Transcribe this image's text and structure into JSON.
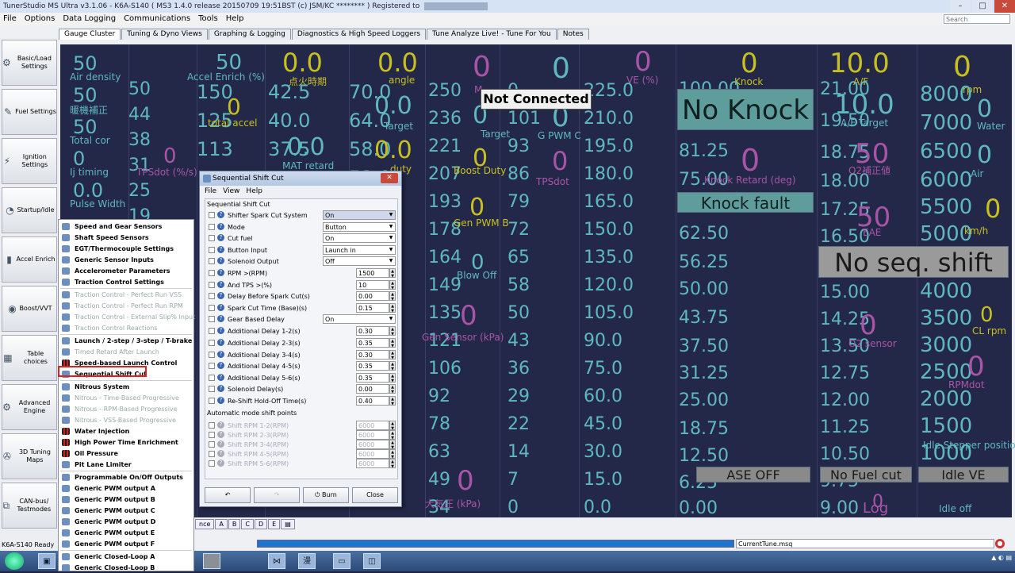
{
  "window": {
    "title": "TunerStudio MS Ultra v3.1.06 - K6A-S140 ( MS3 1.4.0 release   20150709 19:51BST (c) JSM/KC ******** ) Registered to"
  },
  "menubar": [
    "File",
    "Options",
    "Data Logging",
    "Communications",
    "Tools",
    "Help"
  ],
  "search": {
    "placeholder": "Search"
  },
  "tabs": [
    "Gauge Cluster",
    "Tuning & Dyno Views",
    "Graphing & Logging",
    "Diagnostics & High Speed Loggers",
    "Tune Analyze Live! - Tune For You",
    "Notes"
  ],
  "sidebar": [
    {
      "label": "Basic/Load Settings",
      "icon": "gear-icon"
    },
    {
      "label": "Fuel Settings",
      "icon": "injector-icon"
    },
    {
      "label": "Ignition Settings",
      "icon": "spark-icon"
    },
    {
      "label": "Startup/Idle",
      "icon": "gauge-icon"
    },
    {
      "label": "Accel Enrich",
      "icon": "pedal-icon"
    },
    {
      "label": "Boost/VVT",
      "icon": "turbo-icon"
    },
    {
      "label": "Table choices",
      "icon": "table-icon"
    },
    {
      "label": "Advanced Engine",
      "icon": "engine-icon"
    },
    {
      "label": "3D Tuning Maps",
      "icon": "wrench-icon"
    },
    {
      "label": "CAN-bus/ Testmodes",
      "icon": "network-icon"
    }
  ],
  "context_menu": [
    {
      "label": "Speed and Gear Sensors",
      "enabled": true
    },
    {
      "label": "Shaft Speed Sensors",
      "enabled": true
    },
    {
      "label": "EGT/Thermocouple Settings",
      "enabled": true
    },
    {
      "label": "Generic Sensor Inputs",
      "enabled": true
    },
    {
      "label": "Accelerometer Parameters",
      "enabled": true
    },
    {
      "label": "Traction Control Settings",
      "enabled": true
    },
    {
      "label": "Traction Control - Perfect Run VSS",
      "enabled": false
    },
    {
      "label": "Traction Control - Perfect Run RPM",
      "enabled": false
    },
    {
      "label": "Traction Control - External Slip% Input",
      "enabled": false
    },
    {
      "label": "Traction Control Reactions",
      "enabled": false
    },
    {
      "label": "Launch / 2-step / 3-step / T-brake",
      "enabled": true
    },
    {
      "label": "Timed Retard After Launch",
      "enabled": false
    },
    {
      "label": "Speed-based Launch Control",
      "enabled": true
    },
    {
      "label": "Sequential Shift Cut",
      "enabled": true
    },
    {
      "label": "Nitrous System",
      "enabled": true
    },
    {
      "label": "Nitrous - Time-Based Progressive",
      "enabled": false
    },
    {
      "label": "Nitrous - RPM-Based Progressive",
      "enabled": false
    },
    {
      "label": "Nitrous - VSS-Based Progressive",
      "enabled": false
    },
    {
      "label": "Water Injection",
      "enabled": true
    },
    {
      "label": "High Power Time Enrichment",
      "enabled": true
    },
    {
      "label": "Oil Pressure",
      "enabled": true
    },
    {
      "label": "Pit Lane Limiter",
      "enabled": true
    },
    {
      "label": "Programmable On/Off Outputs",
      "enabled": true
    },
    {
      "label": "Generic PWM output A",
      "enabled": true
    },
    {
      "label": "Generic PWM output B",
      "enabled": true
    },
    {
      "label": "Generic PWM output C",
      "enabled": true
    },
    {
      "label": "Generic PWM output D",
      "enabled": true
    },
    {
      "label": "Generic PWM output E",
      "enabled": true
    },
    {
      "label": "Generic PWM output F",
      "enabled": true
    },
    {
      "label": "Generic Closed-Loop A",
      "enabled": true
    },
    {
      "label": "Generic Closed-Loop B",
      "enabled": true
    }
  ],
  "dialog": {
    "title": "Sequential Shift Cut",
    "menu": [
      "File",
      "View",
      "Help"
    ],
    "section": "Sequential Shift Cut",
    "rows": [
      {
        "label": "Shifter Spark Cut System",
        "type": "select",
        "value": "On"
      },
      {
        "label": "Mode",
        "type": "select",
        "value": "Button"
      },
      {
        "label": "Cut fuel",
        "type": "select",
        "value": "On"
      },
      {
        "label": "Button Input",
        "type": "select",
        "value": "Launch in"
      },
      {
        "label": "Solenoid Output",
        "type": "select",
        "value": "Off"
      },
      {
        "label": "RPM >(RPM)",
        "type": "num",
        "value": "1500"
      },
      {
        "label": "And TPS >(%)",
        "type": "num",
        "value": "10"
      },
      {
        "label": "Delay Before Spark Cut(s)",
        "type": "num",
        "value": "0.00"
      },
      {
        "label": "Spark Cut Time (Base)(s)",
        "type": "num",
        "value": "0.15"
      },
      {
        "label": "Gear Based Delay",
        "type": "select",
        "value": "On"
      },
      {
        "label": "Additional Delay 1-2(s)",
        "type": "num",
        "value": "0.30"
      },
      {
        "label": "Additional Delay 2-3(s)",
        "type": "num",
        "value": "0.35"
      },
      {
        "label": "Additional Delay 3-4(s)",
        "type": "num",
        "value": "0.30"
      },
      {
        "label": "Additional Delay 4-5(s)",
        "type": "num",
        "value": "0.35"
      },
      {
        "label": "Additional Delay 5-6(s)",
        "type": "num",
        "value": "0.35"
      },
      {
        "label": "Solenoid Delay(s)",
        "type": "num",
        "value": "0.00"
      },
      {
        "label": "Re-Shift Hold-Off Time(s)",
        "type": "num",
        "value": "0.40"
      }
    ],
    "auto_section": "Automatic mode shift points",
    "auto_rows": [
      {
        "label": "Shift RPM 1-2(RPM)",
        "value": "6000"
      },
      {
        "label": "Shift RPM 2-3(RPM)",
        "value": "6000"
      },
      {
        "label": "Shift RPM 3-4(RPM)",
        "value": "6000"
      },
      {
        "label": "Shift RPM 4-5(RPM)",
        "value": "6000"
      },
      {
        "label": "Shift RPM 5-6(RPM)",
        "value": "6000"
      }
    ],
    "buttons": {
      "undo": "↶",
      "redo": "↷",
      "burn": "Burn",
      "close": "Close"
    }
  },
  "status": {
    "left": "K6A-S140 Ready",
    "tune": "CurrentTune.msq",
    "not_connected": "Not Connected"
  },
  "bottom_tabs": [
    "nce",
    "A",
    "B",
    "C",
    "D",
    "E"
  ],
  "indicators": {
    "no_knock": "No Knock",
    "knock_fault": "Knock fault",
    "no_seq_shift": "No seq. shift",
    "ase_off": "ASE OFF",
    "no_fuel_cut": "No Fuel cut",
    "idle_ve": "Idle VE"
  },
  "gauges": {
    "col1": {
      "values": [
        "50",
        "50",
        "50",
        "0",
        "0.0"
      ],
      "labels": [
        "Air density",
        "暖機補正",
        "Total cor",
        "Ij timing",
        "Pulse Width"
      ]
    },
    "col1b": {
      "values": [
        "50",
        "44",
        "38",
        "31",
        "25",
        "19"
      ]
    },
    "col2": {
      "top": "50",
      "label": "Accel Enrich (%)",
      "values": [
        "150",
        "125",
        "113"
      ],
      "ov1": "0",
      "ovlab1": "total accel",
      "ov2": "0",
      "ovlab2": "TPSdot (%/s)"
    },
    "col3": {
      "top": "0.0",
      "label": "点火時期",
      "values": [
        "42.5",
        "40.0",
        "37.5"
      ],
      "ov": "0.0",
      "ovlab": "MAT retard"
    },
    "col4": {
      "top": "0.0",
      "label": "angle",
      "values": [
        "70.0",
        "64.0",
        "58.0",
        "53.0"
      ],
      "ov1": "0.0",
      "ovlab1": "Target",
      "ov2": "0.0",
      "ovlab2": "duty"
    },
    "col5": {
      "values": [
        "250",
        "236",
        "221",
        "207",
        "193",
        "178",
        "164",
        "149",
        "135",
        "121",
        "106",
        "92",
        "78",
        "63",
        "49",
        "34"
      ],
      "ovs": [
        {
          "v": "0",
          "l": "M"
        },
        {
          "v": "0",
          "l": "Target"
        },
        {
          "v": "0",
          "l": "Boost Duty"
        },
        {
          "v": "0",
          "l": "Gen PWM B"
        },
        {
          "v": "0",
          "l": "Blow Off"
        },
        {
          "v": "0",
          "l": "Gen Sensor (kPa)"
        },
        {
          "v": "0",
          "l": "大気圧 (kPa)"
        }
      ]
    },
    "col6": {
      "values": [
        "0",
        "101",
        "93",
        "86",
        "79",
        "72",
        "65",
        "58",
        "50",
        "43",
        "36",
        "29",
        "22",
        "14",
        "7",
        "0"
      ],
      "ovs": [
        {
          "v": "0",
          "l": "A/F"
        },
        {
          "v": "0",
          "l": "G PWM C"
        },
        {
          "v": "0",
          "l": "TPSdot"
        }
      ]
    },
    "col7": {
      "top": "0",
      "toplabel": "VE (%)",
      "values": [
        "225.0",
        "210.0",
        "195.0",
        "180.0",
        "165.0",
        "150.0",
        "135.0",
        "120.0",
        "105.0",
        "90.0",
        "75.0",
        "60.0",
        "45.0",
        "30.0",
        "15.0",
        "0.0"
      ]
    },
    "col8": {
      "top": "0",
      "toplabel": "Knock",
      "values": [
        "100.00",
        "81.25",
        "75.00",
        "62.50",
        "56.25",
        "50.00",
        "43.75",
        "37.50",
        "31.25",
        "25.00",
        "18.75",
        "12.50",
        "6.25",
        "0.00"
      ],
      "ov": "0",
      "ovlab": "Knock Retard (deg)"
    },
    "col9": {
      "top": "10.0",
      "toplabel": "A/F",
      "values": [
        "21.00",
        "19.50",
        "18.75",
        "18.00",
        "17.25",
        "16.50",
        "15.00",
        "14.25",
        "13.50",
        "12.75",
        "12.00",
        "11.25",
        "10.50",
        "9.75",
        "9.00"
      ],
      "ov1": "10.0",
      "ovlab1": "A/F Target",
      "ov2": "50",
      "ovlab2": "O2補正値",
      "ov3": "50",
      "ovlab3": "EAE",
      "ov4": "0",
      "ovlab4": "O2 sensor",
      "ov5": "0",
      "ovlab5": "Log"
    },
    "col10": {
      "top": "0",
      "toplabel": "rpm",
      "values": [
        "8000",
        "7000",
        "6500",
        "6000",
        "5500",
        "5000",
        "4000",
        "3500",
        "3000",
        "2500",
        "2000",
        "1500",
        "1000"
      ],
      "ovs": [
        {
          "v": "0",
          "l": "Water"
        },
        {
          "v": "0",
          "l": "Air"
        },
        {
          "v": "0",
          "l": "km/h"
        },
        {
          "v": "0",
          "l": "CL rpm"
        },
        {
          "v": "0",
          "l": "RPMdot"
        },
        {
          "v": "",
          "l": "Idle Stepper position"
        },
        {
          "v": "",
          "l": "Idle off"
        }
      ]
    }
  }
}
